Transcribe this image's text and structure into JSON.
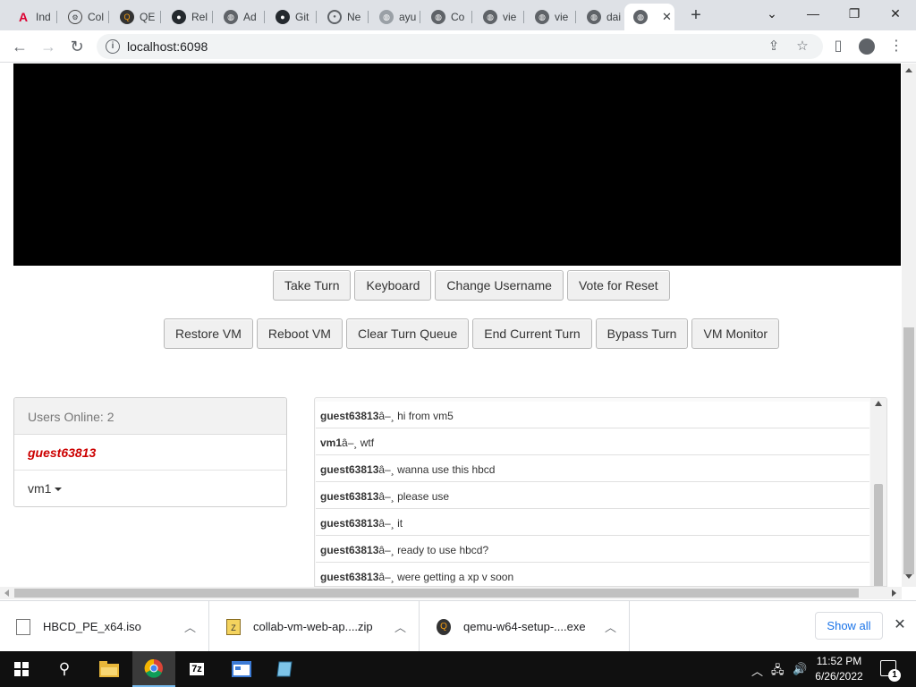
{
  "browser": {
    "tabs": [
      {
        "title": "Ind",
        "icon": "angular-icon",
        "color": "#dd0031"
      },
      {
        "title": "Col",
        "icon": "collab-icon",
        "color": "#444444"
      },
      {
        "title": "QE",
        "icon": "qemu-icon",
        "color": "#c0392b"
      },
      {
        "title": "Rel",
        "icon": "github-icon",
        "color": "#24292e"
      },
      {
        "title": "Ad",
        "icon": "globe-icon",
        "color": "#5f6368"
      },
      {
        "title": "Git",
        "icon": "github-icon",
        "color": "#24292e"
      },
      {
        "title": "Ne",
        "icon": "chrome-icon",
        "color": "#5f6368"
      },
      {
        "title": "ayu",
        "icon": "globe-icon",
        "color": "#5f6368"
      },
      {
        "title": "Co",
        "icon": "globe-icon",
        "color": "#5f6368"
      },
      {
        "title": "vie",
        "icon": "globe-icon",
        "color": "#5f6368"
      },
      {
        "title": "vie",
        "icon": "globe-icon",
        "color": "#5f6368"
      },
      {
        "title": "dai",
        "icon": "globe-icon",
        "color": "#5f6368"
      }
    ],
    "url": "localhost:6098"
  },
  "vm": {
    "buttons_row1": [
      "Take Turn",
      "Keyboard",
      "Change Username",
      "Vote for Reset"
    ],
    "buttons_row2": [
      "Restore VM",
      "Reboot VM",
      "Clear Turn Queue",
      "End Current Turn",
      "Bypass Turn",
      "VM Monitor"
    ]
  },
  "users": {
    "header": "Users Online: 2",
    "list": [
      "guest63813",
      "vm1"
    ]
  },
  "chat": {
    "separator": "â–¸",
    "messages": [
      {
        "user": "guest63813",
        "text": "hi from vm5"
      },
      {
        "user": "vm1",
        "text": "wtf"
      },
      {
        "user": "guest63813",
        "text": "wanna use this hbcd"
      },
      {
        "user": "guest63813",
        "text": "please use"
      },
      {
        "user": "guest63813",
        "text": "it"
      },
      {
        "user": "guest63813",
        "text": "ready to use hbcd?"
      },
      {
        "user": "guest63813",
        "text": "were getting a xp v soon"
      }
    ]
  },
  "downloads": {
    "items": [
      {
        "name": "HBCD_PE_x64.iso",
        "icon": "file-icon"
      },
      {
        "name": "collab-vm-web-ap....zip",
        "icon": "zip-icon"
      },
      {
        "name": "qemu-w64-setup-....exe",
        "icon": "qemu-icon"
      }
    ],
    "show_all": "Show all"
  },
  "taskbar": {
    "time": "11:52 PM",
    "date": "6/26/2022",
    "notification_count": "1",
    "apps": [
      "file-explorer-icon",
      "chrome-icon",
      "7zip-icon",
      "app-window-icon",
      "notepad-icon"
    ]
  }
}
